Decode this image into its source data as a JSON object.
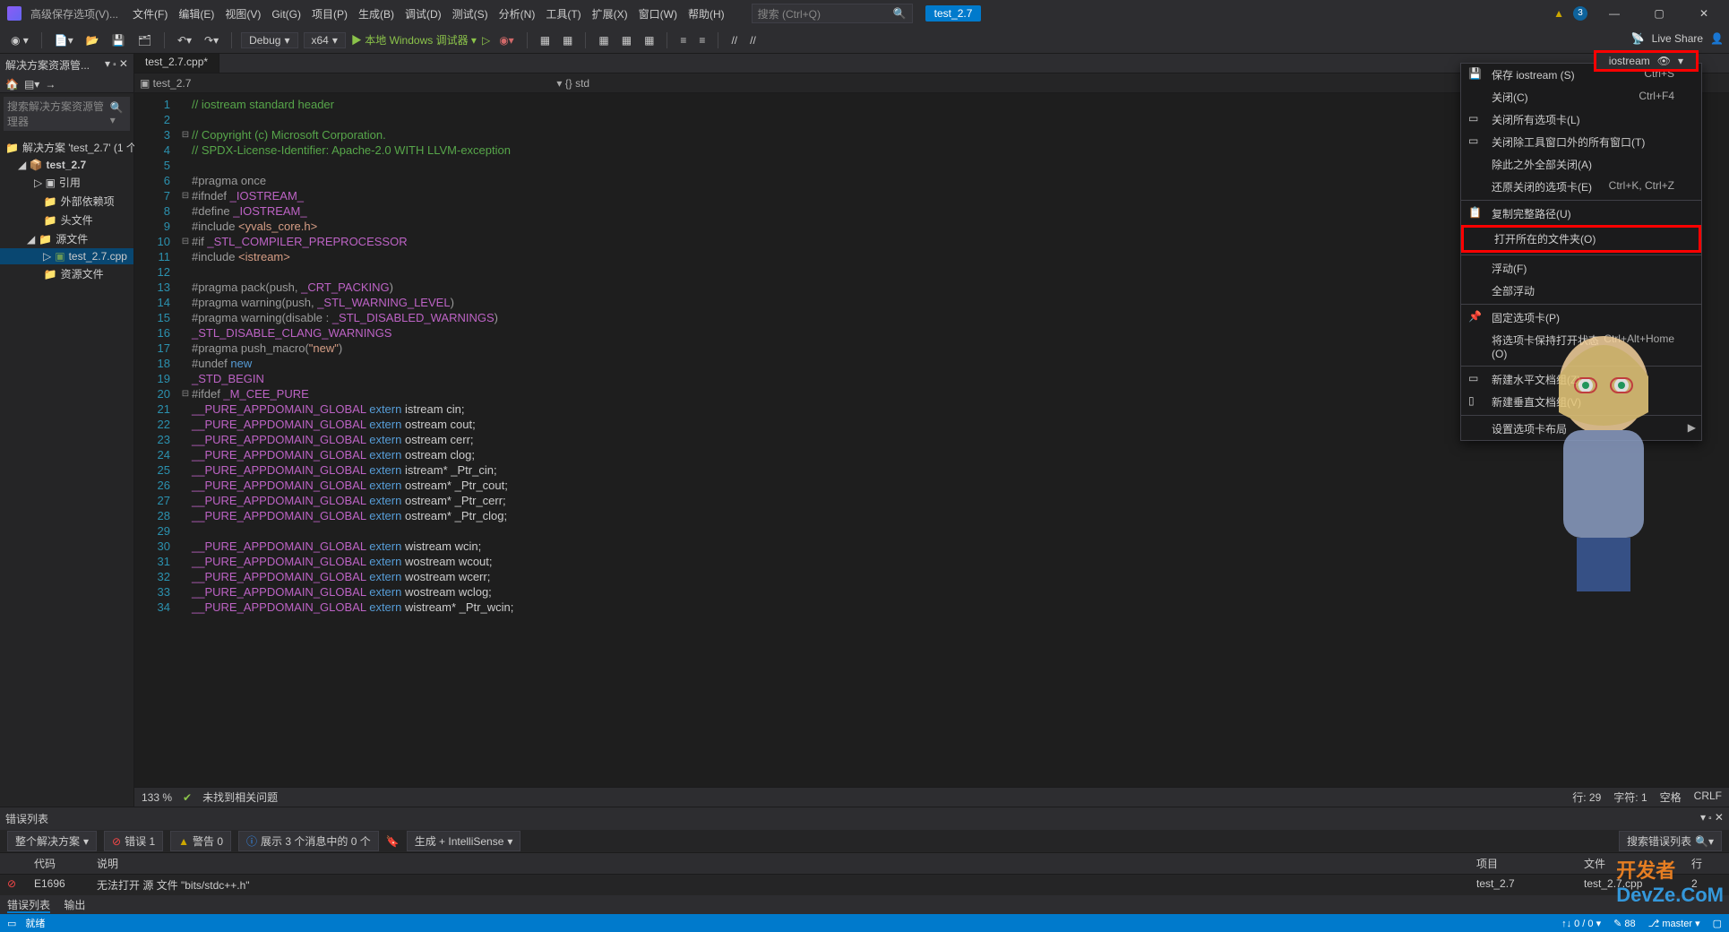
{
  "title": "高级保存选项(V)...",
  "menus": [
    "文件(F)",
    "编辑(E)",
    "视图(V)",
    "Git(G)",
    "项目(P)",
    "生成(B)",
    "调试(D)",
    "测试(S)",
    "分析(N)",
    "工具(T)",
    "扩展(X)",
    "窗口(W)",
    "帮助(H)"
  ],
  "search_placeholder": "搜索 (Ctrl+Q)",
  "project_pill": "test_2.7",
  "notif_count": "3",
  "toolbar": {
    "config": "Debug",
    "platform": "x64",
    "run": "本地 Windows 调试器"
  },
  "live_share": "Live Share",
  "solution": {
    "panel_title": "解决方案资源管...",
    "search": "搜索解决方案资源管理器",
    "root": "解决方案 'test_2.7' (1 个",
    "project": "test_2.7",
    "refs": "引用",
    "ext_deps": "外部依赖项",
    "headers": "头文件",
    "sources": "源文件",
    "cpp": "test_2.7.cpp",
    "resources": "资源文件"
  },
  "editor": {
    "tab": "test_2.7.cpp*",
    "nav_left": "test_2.7",
    "nav_right": "{} std",
    "right_tab": "iostream",
    "code_lines": [
      {
        "n": 1,
        "html": "<span class='c-comment'>// iostream standard header</span>"
      },
      {
        "n": 2,
        "html": ""
      },
      {
        "n": 3,
        "fold": "⊟",
        "html": "<span class='c-comment'>// Copyright (c) Microsoft Corporation.</span>"
      },
      {
        "n": 4,
        "html": "<span class='c-comment'>// SPDX-License-Identifier: Apache-2.0 WITH LLVM-exception</span>"
      },
      {
        "n": 5,
        "html": ""
      },
      {
        "n": 6,
        "html": "<span class='c-pp'>#pragma once</span>"
      },
      {
        "n": 7,
        "fold": "⊟",
        "html": "<span class='c-pp'>#ifndef </span><span class='c-macro'>_IOSTREAM_</span>"
      },
      {
        "n": 8,
        "html": "<span class='c-pp'>#define </span><span class='c-macro'>_IOSTREAM_</span>"
      },
      {
        "n": 9,
        "html": "<span class='c-pp'>#include </span><span class='c-str'>&lt;yvals_core.h&gt;</span>"
      },
      {
        "n": 10,
        "fold": "⊟",
        "html": "<span class='c-pp'>#if </span><span class='c-macro'>_STL_COMPILER_PREPROCESSOR</span>"
      },
      {
        "n": 11,
        "html": "<span class='c-pp'>#include </span><span class='c-str'>&lt;istream&gt;</span>"
      },
      {
        "n": 12,
        "html": ""
      },
      {
        "n": 13,
        "html": "<span class='c-pp'>#pragma pack(push, </span><span class='c-macro'>_CRT_PACKING</span><span class='c-pp'>)</span>"
      },
      {
        "n": 14,
        "html": "<span class='c-pp'>#pragma warning(push, </span><span class='c-macro'>_STL_WARNING_LEVEL</span><span class='c-pp'>)</span>"
      },
      {
        "n": 15,
        "html": "<span class='c-pp'>#pragma warning(disable : </span><span class='c-macro'>_STL_DISABLED_WARNINGS</span><span class='c-pp'>)</span>"
      },
      {
        "n": 16,
        "html": "<span class='c-macro'>_STL_DISABLE_CLANG_WARNINGS</span>"
      },
      {
        "n": 17,
        "html": "<span class='c-pp'>#pragma push_macro(</span><span class='c-str'>\"new\"</span><span class='c-pp'>)</span>"
      },
      {
        "n": 18,
        "html": "<span class='c-pp'>#undef </span><span class='c-kw'>new</span>"
      },
      {
        "n": 19,
        "html": "<span class='c-macro'>_STD_BEGIN</span>"
      },
      {
        "n": 20,
        "fold": "⊟",
        "html": "<span class='c-pp'>#ifdef </span><span class='c-macro'>_M_CEE_PURE</span>"
      },
      {
        "n": 21,
        "html": "<span class='c-macro'>__PURE_APPDOMAIN_GLOBAL</span> <span class='c-kw'>extern</span> istream cin;"
      },
      {
        "n": 22,
        "html": "<span class='c-macro'>__PURE_APPDOMAIN_GLOBAL</span> <span class='c-kw'>extern</span> ostream cout;"
      },
      {
        "n": 23,
        "html": "<span class='c-macro'>__PURE_APPDOMAIN_GLOBAL</span> <span class='c-kw'>extern</span> ostream cerr;"
      },
      {
        "n": 24,
        "html": "<span class='c-macro'>__PURE_APPDOMAIN_GLOBAL</span> <span class='c-kw'>extern</span> ostream clog;"
      },
      {
        "n": 25,
        "html": "<span class='c-macro'>__PURE_APPDOMAIN_GLOBAL</span> <span class='c-kw'>extern</span> istream* _Ptr_cin;"
      },
      {
        "n": 26,
        "html": "<span class='c-macro'>__PURE_APPDOMAIN_GLOBAL</span> <span class='c-kw'>extern</span> ostream* _Ptr_cout;"
      },
      {
        "n": 27,
        "html": "<span class='c-macro'>__PURE_APPDOMAIN_GLOBAL</span> <span class='c-kw'>extern</span> ostream* _Ptr_cerr;"
      },
      {
        "n": 28,
        "html": "<span class='c-macro'>__PURE_APPDOMAIN_GLOBAL</span> <span class='c-kw'>extern</span> ostream* _Ptr_clog;"
      },
      {
        "n": 29,
        "html": ""
      },
      {
        "n": 30,
        "html": "<span class='c-macro'>__PURE_APPDOMAIN_GLOBAL</span> <span class='c-kw'>extern</span> wistream wcin;"
      },
      {
        "n": 31,
        "html": "<span class='c-macro'>__PURE_APPDOMAIN_GLOBAL</span> <span class='c-kw'>extern</span> wostream wcout;"
      },
      {
        "n": 32,
        "html": "<span class='c-macro'>__PURE_APPDOMAIN_GLOBAL</span> <span class='c-kw'>extern</span> wostream wcerr;"
      },
      {
        "n": 33,
        "html": "<span class='c-macro'>__PURE_APPDOMAIN_GLOBAL</span> <span class='c-kw'>extern</span> wostream wclog;"
      },
      {
        "n": 34,
        "html": "<span class='c-macro'>__PURE_APPDOMAIN_GLOBAL</span> <span class='c-kw'>extern</span> wistream* _Ptr_wcin;"
      }
    ],
    "zoom": "133 %",
    "issues": "未找到相关问题",
    "line": "行: 29",
    "col": "字符: 1",
    "ws": "空格",
    "le": "CRLF"
  },
  "error_panel": {
    "title": "错误列表",
    "scope": "整个解决方案",
    "errors": "错误 1",
    "warnings": "警告 0",
    "messages": "展示 3 个消息中的 0 个",
    "intellisense": "生成 + IntelliSense",
    "search": "搜索错误列表",
    "cols": {
      "code": "代码",
      "desc": "说明",
      "proj": "项目",
      "file": "文件",
      "line": "行"
    },
    "row": {
      "code": "E1696",
      "desc": "无法打开 源 文件 \"bits/stdc++.h\"",
      "proj": "test_2.7",
      "file": "test_2.7.cpp",
      "line": "2"
    },
    "tabs": {
      "errors": "错误列表",
      "output": "输出"
    }
  },
  "context_menu": [
    {
      "icon": "💾",
      "label": "保存 iostream (S)",
      "shortcut": "Ctrl+S"
    },
    {
      "label": "关闭(C)",
      "shortcut": "Ctrl+F4"
    },
    {
      "icon": "▭",
      "label": "关闭所有选项卡(L)"
    },
    {
      "icon": "▭",
      "label": "关闭除工具窗口外的所有窗口(T)"
    },
    {
      "label": "除此之外全部关闭(A)"
    },
    {
      "label": "还原关闭的选项卡(E)",
      "shortcut": "Ctrl+K, Ctrl+Z"
    },
    {
      "sep": true
    },
    {
      "icon": "📋",
      "label": "复制完整路径(U)"
    },
    {
      "label": "打开所在的文件夹(O)",
      "highlight": true
    },
    {
      "sep": true
    },
    {
      "label": "浮动(F)"
    },
    {
      "label": "全部浮动"
    },
    {
      "sep": true
    },
    {
      "icon": "📌",
      "label": "固定选项卡(P)"
    },
    {
      "label": "将选项卡保持打开状态(O)",
      "shortcut": "Ctrl+Alt+Home"
    },
    {
      "sep": true
    },
    {
      "icon": "▭",
      "label": "新建水平文档组(Z)"
    },
    {
      "icon": "▯",
      "label": "新建垂直文档组(V)"
    },
    {
      "sep": true
    },
    {
      "label": "设置选项卡布局",
      "arrow": true
    }
  ],
  "statusbar": {
    "ready": "就绪",
    "ln": "↑↓ 0 / 0 ▾",
    "repo": "88",
    "branch": "master ▾",
    "add": "▢"
  },
  "watermark": "开发者 DevZe.CoM"
}
